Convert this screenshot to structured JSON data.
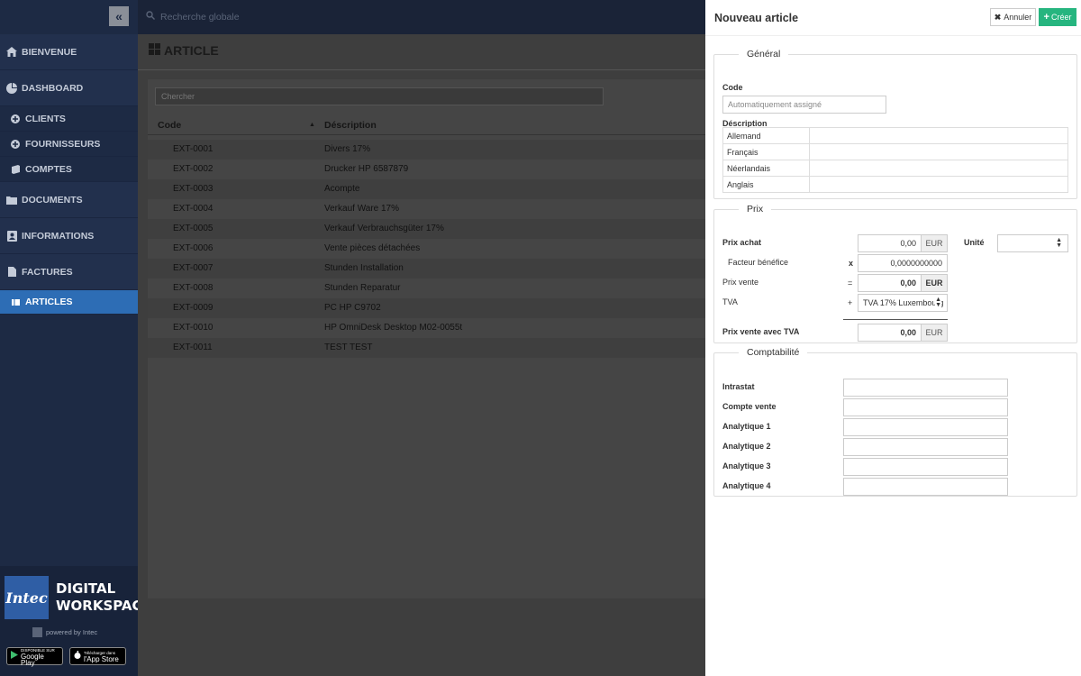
{
  "sidebar": {
    "collapse_icon": "double-chevron-left-icon",
    "items": [
      {
        "label": "BIENVENUE",
        "icon": "home-icon"
      },
      {
        "label": "DASHBOARD",
        "icon": "pie-chart-icon"
      },
      {
        "label": "CLIENTS",
        "icon": "circle-plus-icon"
      },
      {
        "label": "FOURNISSEURS",
        "icon": "circle-plus-icon"
      },
      {
        "label": "COMPTES",
        "icon": "book-icon"
      },
      {
        "label": "DOCUMENTS",
        "icon": "folder-icon"
      },
      {
        "label": "INFORMATIONS",
        "icon": "contact-icon"
      },
      {
        "label": "FACTURES",
        "icon": "file-icon"
      },
      {
        "label": "ARTICLES",
        "icon": "list-icon"
      }
    ],
    "active": "ARTICLES",
    "brand": {
      "logo_text": "Intec",
      "line1": "DIGITAL",
      "line2": "WORKSPACE",
      "powered": "powered by Intec",
      "google_small": "DISPONIBLE SUR",
      "google_big": "Google Play",
      "apple_small": "Télécharger dans",
      "apple_big": "l'App Store"
    }
  },
  "topbar": {
    "search_placeholder": "Recherche globale"
  },
  "main": {
    "title": "ARTICLE",
    "search_placeholder": "Chercher",
    "columns": {
      "code": "Code",
      "description": "Déscription"
    },
    "rows": [
      {
        "code": "EXT-0001",
        "description": "Divers 17%"
      },
      {
        "code": "EXT-0002",
        "description": "Drucker HP 6587879"
      },
      {
        "code": "EXT-0003",
        "description": "Acompte"
      },
      {
        "code": "EXT-0004",
        "description": "Verkauf Ware 17%"
      },
      {
        "code": "EXT-0005",
        "description": "Verkauf Verbrauchsgüter 17%"
      },
      {
        "code": "EXT-0006",
        "description": "Vente pièces détachées"
      },
      {
        "code": "EXT-0007",
        "description": "Stunden Installation"
      },
      {
        "code": "EXT-0008",
        "description": "Stunden Reparatur"
      },
      {
        "code": "EXT-0009",
        "description": "PC HP C9702"
      },
      {
        "code": "EXT-0010",
        "description": "HP OmniDesk Desktop M02-0055t"
      },
      {
        "code": "EXT-0011",
        "description": "TEST TEST"
      }
    ]
  },
  "drawer": {
    "title": "Nouveau article",
    "cancel_label": "Annuler",
    "create_label": "Créer",
    "general": {
      "legend": "Général",
      "code_label": "Code",
      "code_placeholder": "Automatiquement assigné",
      "description_label": "Déscription",
      "languages": [
        "Allemand",
        "Français",
        "Néerlandais",
        "Anglais"
      ]
    },
    "prix": {
      "legend": "Prix",
      "achat_label": "Prix achat",
      "achat_value": "0,00",
      "facteur_label": "Facteur bénéfice",
      "facteur_symbol": "x",
      "facteur_value": "0,0000000000",
      "vente_label": "Prix vente",
      "vente_symbol": "=",
      "vente_value": "0,00",
      "tva_label": "TVA",
      "tva_symbol": "+",
      "tva_value": "TVA 17% Luxembourg",
      "ttc_label": "Prix vente avec TVA",
      "ttc_value": "0,00",
      "currency": "EUR",
      "unite_label": "Unité",
      "unite_value": ""
    },
    "compta": {
      "legend": "Comptabilité",
      "fields": [
        "Intrastat",
        "Compte vente",
        "Analytique 1",
        "Analytique 2",
        "Analytique 3",
        "Analytique 4"
      ]
    }
  },
  "colors": {
    "sidebar_bg": "#1d2a44",
    "active": "#2d6db5",
    "create": "#26b57f"
  }
}
